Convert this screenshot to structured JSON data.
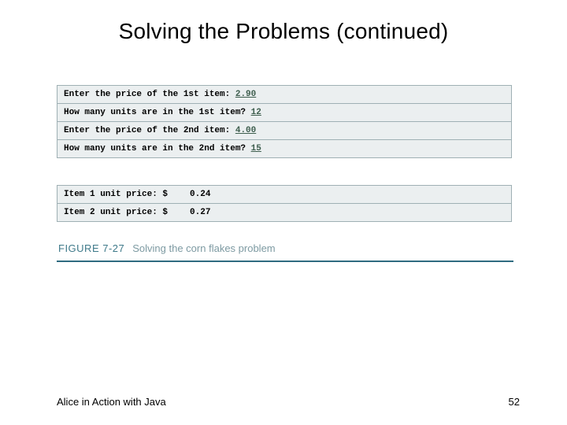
{
  "title": "Solving the Problems (continued)",
  "console": {
    "rows": [
      {
        "prompt": "Enter the price of the 1st item: ",
        "input": "2.90"
      },
      {
        "prompt": "How many units are in the 1st item? ",
        "input": "12"
      },
      {
        "prompt": "Enter the price of the 2nd item: ",
        "input": "4.00"
      },
      {
        "prompt": "How many units are in the 2nd item? ",
        "input": "15"
      }
    ]
  },
  "results": {
    "rows": [
      {
        "label": "Item 1 unit price: $",
        "value": "0.24"
      },
      {
        "label": "Item 2 unit price: $",
        "value": "0.27"
      }
    ]
  },
  "figure": {
    "number": "FIGURE 7-27",
    "caption": "Solving the corn flakes problem"
  },
  "footer": {
    "left": "Alice in Action with Java",
    "page": "52"
  }
}
